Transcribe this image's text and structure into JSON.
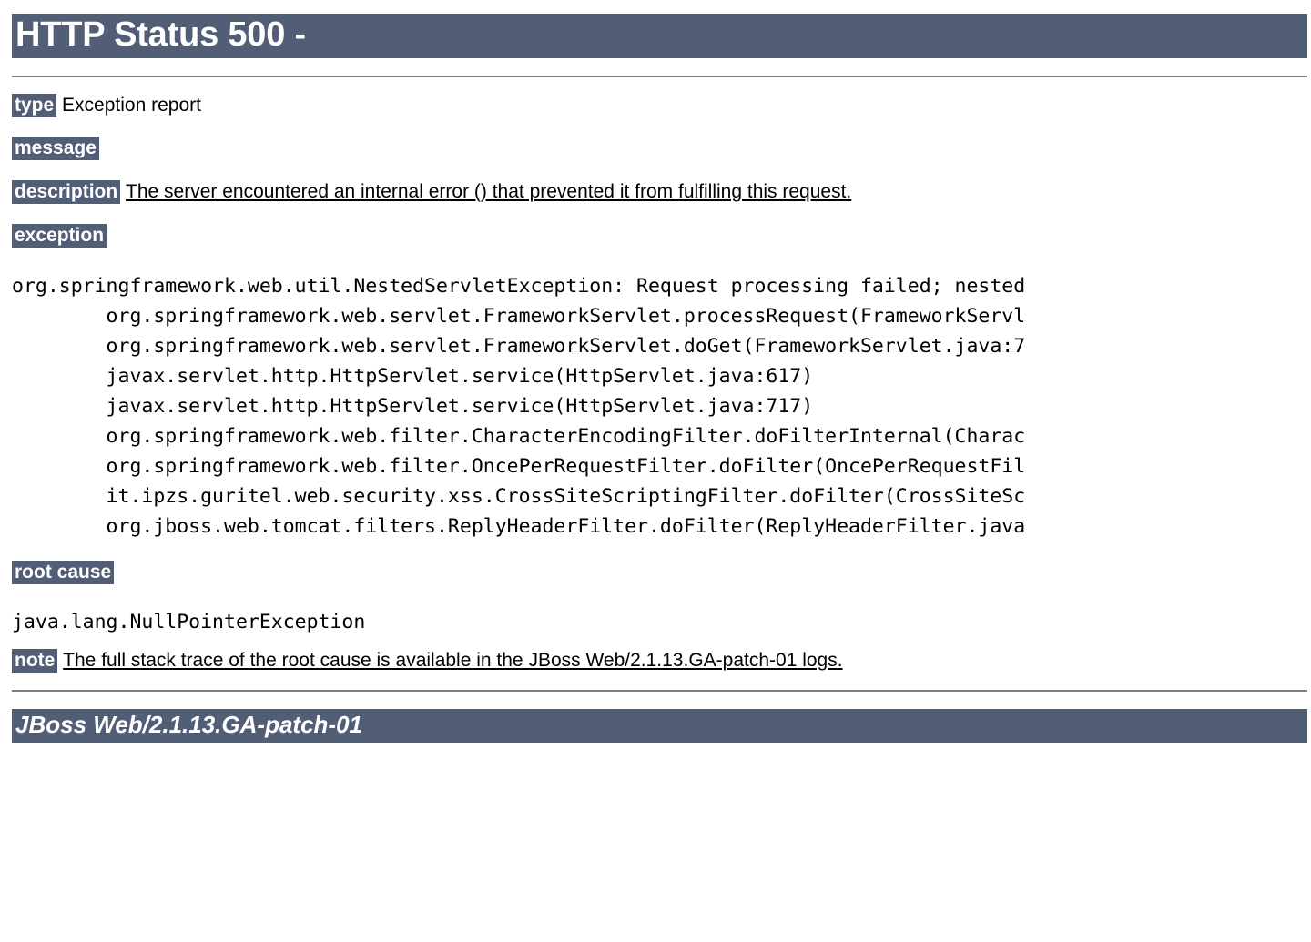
{
  "page": {
    "title": "HTTP Status 500 -",
    "server": "JBoss Web/2.1.13.GA-patch-01"
  },
  "colors": {
    "bar_background": "#525D76",
    "bar_text": "#FFFFFF",
    "rule": "#808080",
    "body_text": "#000000",
    "page_background": "#FFFFFF"
  },
  "fields": {
    "type": {
      "label": "type",
      "value": "Exception report"
    },
    "message": {
      "label": "message",
      "value": ""
    },
    "description": {
      "label": "description",
      "value": "The server encountered an internal error () that prevented it from fulfilling this request."
    },
    "exception": {
      "label": "exception"
    },
    "root_cause": {
      "label": "root cause"
    },
    "note": {
      "label": "note",
      "value": "The full stack trace of the root cause is available in the JBoss Web/2.1.13.GA-patch-01 logs."
    }
  },
  "exception_trace": "org.springframework.web.util.NestedServletException: Request processing failed; nested\n        org.springframework.web.servlet.FrameworkServlet.processRequest(FrameworkServl\n        org.springframework.web.servlet.FrameworkServlet.doGet(FrameworkServlet.java:7\n        javax.servlet.http.HttpServlet.service(HttpServlet.java:617)\n        javax.servlet.http.HttpServlet.service(HttpServlet.java:717)\n        org.springframework.web.filter.CharacterEncodingFilter.doFilterInternal(Charac\n        org.springframework.web.filter.OncePerRequestFilter.doFilter(OncePerRequestFil\n        it.ipzs.guritel.web.security.xss.CrossSiteScriptingFilter.doFilter(CrossSiteSc\n        org.jboss.web.tomcat.filters.ReplyHeaderFilter.doFilter(ReplyHeaderFilter.java",
  "root_cause_trace": "java.lang.NullPointerException"
}
